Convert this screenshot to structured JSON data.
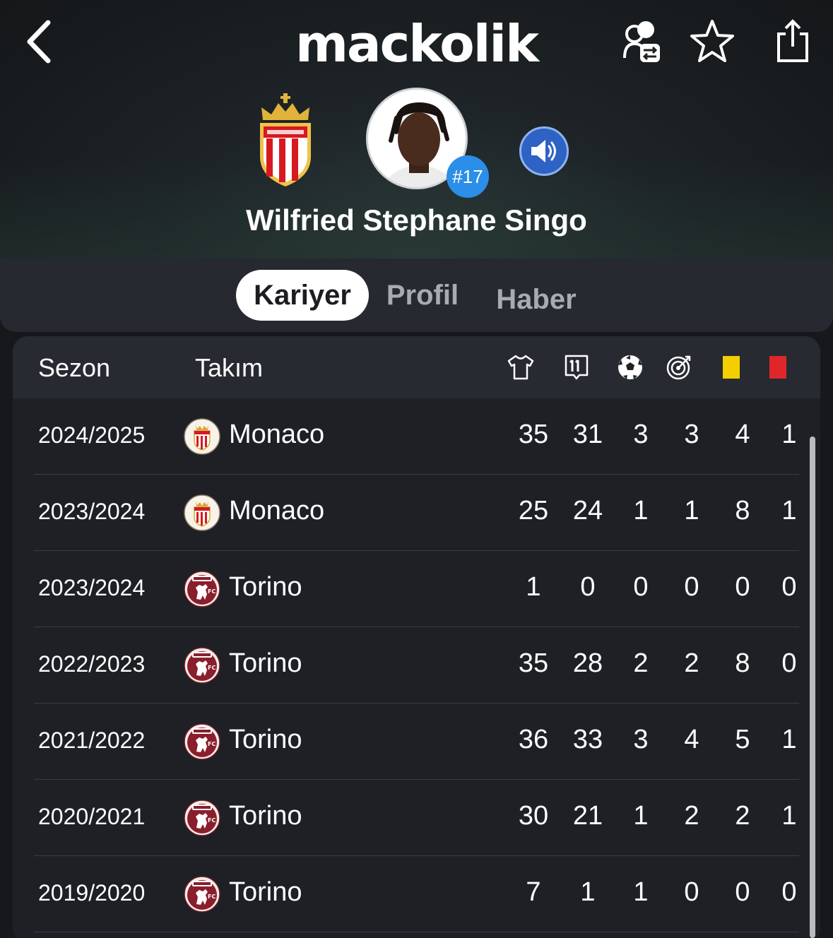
{
  "app": {
    "logo": "mackolik"
  },
  "player": {
    "name": "Wilfried Stephane Singo",
    "number": "#17"
  },
  "tabs": [
    {
      "label": "Kariyer",
      "active": true
    },
    {
      "label": "Profil",
      "active": false
    },
    {
      "label": "Haber",
      "active": false
    }
  ],
  "table": {
    "headers": {
      "season": "Sezon",
      "team": "Takım",
      "stat_icons": [
        "shirt-icon",
        "lineup-icon",
        "ball-icon",
        "target-icon",
        "yellow-card-icon",
        "red-card-icon"
      ]
    },
    "rows": [
      {
        "season": "2024/2025",
        "team": "Monaco",
        "crest": "monaco-crest-icon",
        "stats": [
          "35",
          "31",
          "3",
          "3",
          "4",
          "1"
        ]
      },
      {
        "season": "2023/2024",
        "team": "Monaco",
        "crest": "monaco-crest-icon",
        "stats": [
          "25",
          "24",
          "1",
          "1",
          "8",
          "1"
        ]
      },
      {
        "season": "2023/2024",
        "team": "Torino",
        "crest": "torino-crest-icon",
        "stats": [
          "1",
          "0",
          "0",
          "0",
          "0",
          "0"
        ]
      },
      {
        "season": "2022/2023",
        "team": "Torino",
        "crest": "torino-crest-icon",
        "stats": [
          "35",
          "28",
          "2",
          "2",
          "8",
          "0"
        ]
      },
      {
        "season": "2021/2022",
        "team": "Torino",
        "crest": "torino-crest-icon",
        "stats": [
          "36",
          "33",
          "3",
          "4",
          "5",
          "1"
        ]
      },
      {
        "season": "2020/2021",
        "team": "Torino",
        "crest": "torino-crest-icon",
        "stats": [
          "30",
          "21",
          "1",
          "2",
          "2",
          "1"
        ]
      },
      {
        "season": "2019/2020",
        "team": "Torino",
        "crest": "torino-crest-icon",
        "stats": [
          "7",
          "1",
          "1",
          "0",
          "0",
          "0"
        ]
      }
    ]
  },
  "colors": {
    "accent_blue": "#2b8ee8",
    "yellow_card": "#f4cf00",
    "red_card": "#e0262b",
    "monaco_red": "#d71920",
    "torino_maroon": "#8b1e2c"
  }
}
